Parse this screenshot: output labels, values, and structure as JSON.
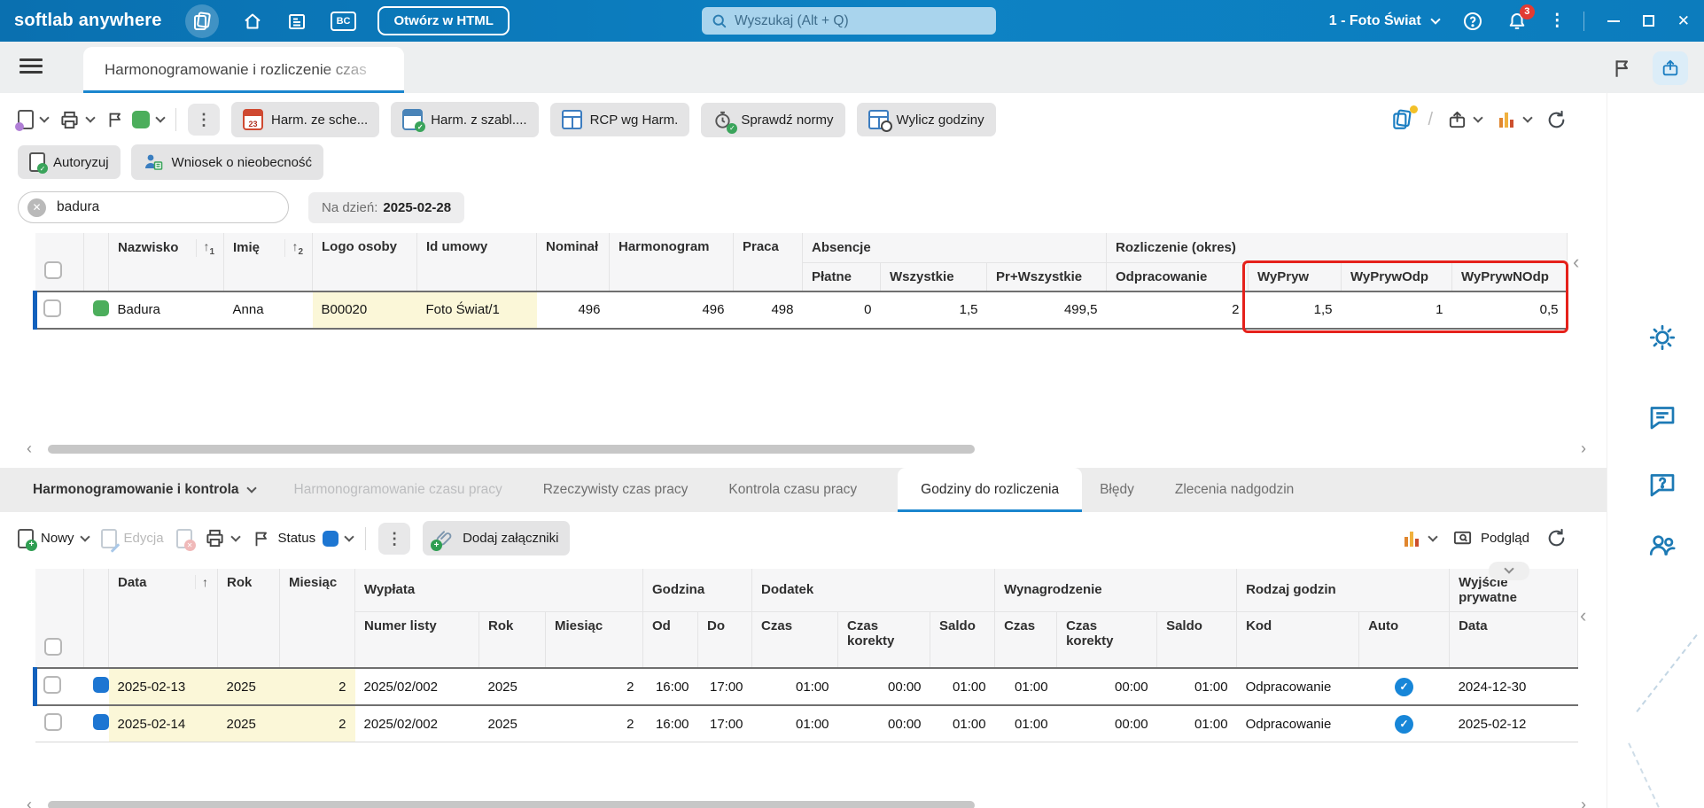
{
  "colors": {
    "accent": "#0d7fc0",
    "selection_blue": "#1261bd",
    "status_green": "#4cae5c",
    "status_blue": "#1d76d2",
    "annotation_red": "#e5211b",
    "cell_yellow": "#fbf7d8"
  },
  "icons": {
    "kebab": "⋮",
    "slash": "/",
    "sort_up": "↑",
    "scroll_left": "‹",
    "scroll_right": "›",
    "close": "✕",
    "check": "✓",
    "question": "?"
  },
  "topbar": {
    "logo": "softlab anywhere",
    "bc": "BC",
    "open_html": "Otwórz w HTML",
    "search_placeholder": "Wyszukaj (Alt + Q)",
    "company": "1 - Foto Świat",
    "notifications": "3"
  },
  "tabs": {
    "main_tab": "Harmonogramowanie i rozliczenie czas"
  },
  "toolbar": {
    "calendar_day": "23",
    "harm_sche": "Harm. ze sche...",
    "harm_szabl": "Harm. z szabl....",
    "rcp": "RCP wg Harm.",
    "sprawdz": "Sprawdź normy",
    "wylicz": "Wylicz godziny",
    "autoryzuj": "Autoryzuj",
    "wniosek": "Wniosek o nieobecność"
  },
  "filter": {
    "search_value": "badura",
    "date_label": "Na dzień:",
    "date_value": "2025-02-28"
  },
  "employees": {
    "headers": {
      "nazwisko": "Nazwisko",
      "imie": "Imię",
      "logo": "Logo osoby",
      "umowa": "Id umowy",
      "nominal": "Nominał",
      "harmonogram": "Harmonogram",
      "praca": "Praca",
      "absencje": "Absencje",
      "rozliczenie": "Rozliczenie (okres)",
      "platne": "Płatne",
      "wszystkie": "Wszystkie",
      "pr_wszystkie": "Pr+Wszystkie",
      "odpracowanie": "Odpracowanie",
      "wypryw": "WyPryw",
      "wyprywodp": "WyPrywOdp",
      "wyprywnodp": "WyPrywNOdp",
      "sort1": "1",
      "sort2": "2"
    },
    "row": {
      "nazwisko": "Badura",
      "imie": "Anna",
      "logo": "B00020",
      "umowa": "Foto Świat/1",
      "nominal": "496",
      "harmonogram": "496",
      "praca": "498",
      "platne": "0",
      "wszystkie": "1,5",
      "pr_wszystkie": "499,5",
      "odpracowanie": "2",
      "wypryw": "1,5",
      "wyprywodp": "1",
      "wyprywnodp": "0,5"
    }
  },
  "bottom_nav": {
    "selector": "Harmonogramowanie i kontrola",
    "tab1": "Harmonogramowanie czasu pracy",
    "tab2": "Rzeczywisty czas pracy",
    "tab3": "Kontrola czasu pracy",
    "tab4": "Godziny do rozliczenia",
    "tab5": "Błędy",
    "tab6": "Zlecenia nadgodzin"
  },
  "toolbar2": {
    "nowy": "Nowy",
    "edycja": "Edycja",
    "status": "Status",
    "zalaczniki": "Dodaj załączniki",
    "podglad": "Podgląd"
  },
  "hours": {
    "headers": {
      "data": "Data",
      "rok": "Rok",
      "miesiac": "Miesiąc",
      "wyplata": "Wypłata",
      "numer_listy": "Numer listy",
      "rok2": "Rok",
      "miesiac2": "Miesiąc",
      "godzina": "Godzina",
      "od": "Od",
      "do": "Do",
      "dodatek": "Dodatek",
      "czas": "Czas",
      "czas_korekty": "Czas korekty",
      "saldo": "Saldo",
      "wynagrodzenie": "Wynagrodzenie",
      "czas2": "Czas",
      "czas_korekty2": "Czas korekty",
      "saldo2": "Saldo",
      "rodzaj": "Rodzaj godzin",
      "kod": "Kod",
      "auto": "Auto",
      "wyjscie": "Wyjście prywatne",
      "data2": "Data"
    },
    "rows": [
      {
        "data": "2025-02-13",
        "rok": "2025",
        "miesiac": "2",
        "numer": "2025/02/002",
        "w_rok": "2025",
        "w_miesiac": "2",
        "od": "16:00",
        "do": "17:00",
        "d_czas": "01:00",
        "d_korekta": "00:00",
        "d_saldo": "01:00",
        "w_czas": "01:00",
        "w_korekta": "00:00",
        "w_saldo": "01:00",
        "kod": "Odpracowanie",
        "wyjscie": "2024-12-30"
      },
      {
        "data": "2025-02-14",
        "rok": "2025",
        "miesiac": "2",
        "numer": "2025/02/002",
        "w_rok": "2025",
        "w_miesiac": "2",
        "od": "16:00",
        "do": "17:00",
        "d_czas": "01:00",
        "d_korekta": "00:00",
        "d_saldo": "01:00",
        "w_czas": "01:00",
        "w_korekta": "00:00",
        "w_saldo": "01:00",
        "kod": "Odpracowanie",
        "wyjscie": "2025-02-12"
      }
    ]
  }
}
